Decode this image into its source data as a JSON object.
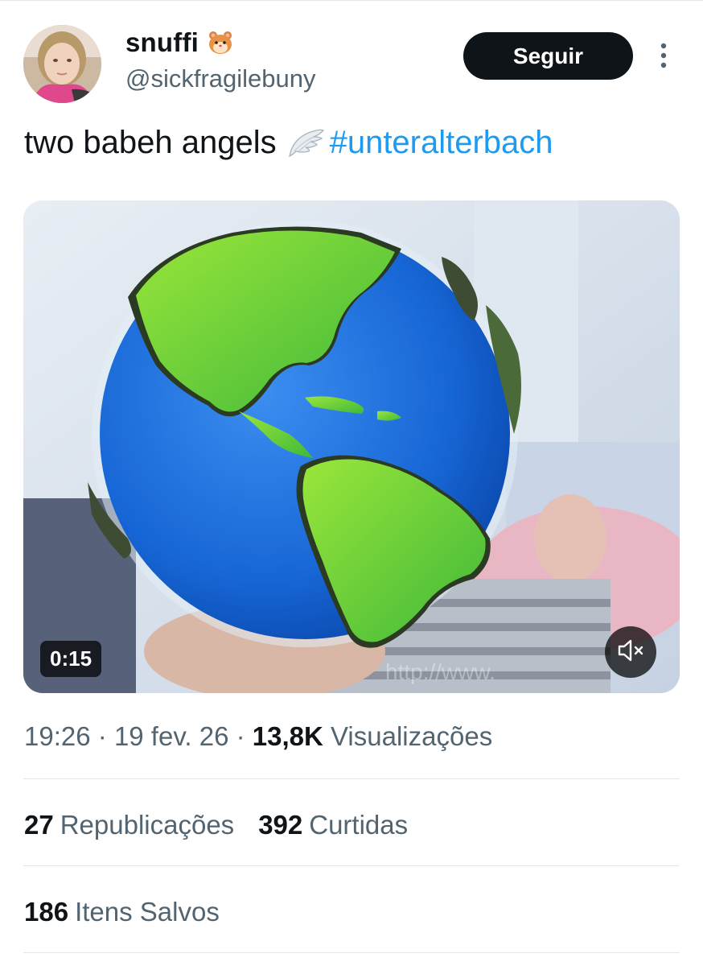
{
  "author": {
    "display_name": "snuffi",
    "name_emoji": "hamster-icon",
    "handle": "@sickfragilebuny"
  },
  "follow_button": {
    "label": "Seguir"
  },
  "more_menu": {
    "icon": "more-vertical-icon"
  },
  "tweet": {
    "text": "two babeh angels",
    "text_emoji": "wing-icon",
    "hashtag": "#unteralterbach"
  },
  "media": {
    "type": "video",
    "duration": "0:15",
    "mute_icon": "speaker-muted-icon",
    "watermark": "http://www."
  },
  "meta": {
    "time": "19:26",
    "separator": "·",
    "date": "19 fev. 26",
    "views_count": "13,8K",
    "views_label": "Visualizações"
  },
  "stats": {
    "reposts_count": "27",
    "reposts_label": "Republicações",
    "likes_count": "392",
    "likes_label": "Curtidas",
    "bookmarks_count": "186",
    "bookmarks_label": "Itens Salvos"
  },
  "colors": {
    "text": "#0f1419",
    "secondary": "#536471",
    "link": "#1d9bf0",
    "button_bg": "#0f1419",
    "divider": "#e1e8ed"
  }
}
